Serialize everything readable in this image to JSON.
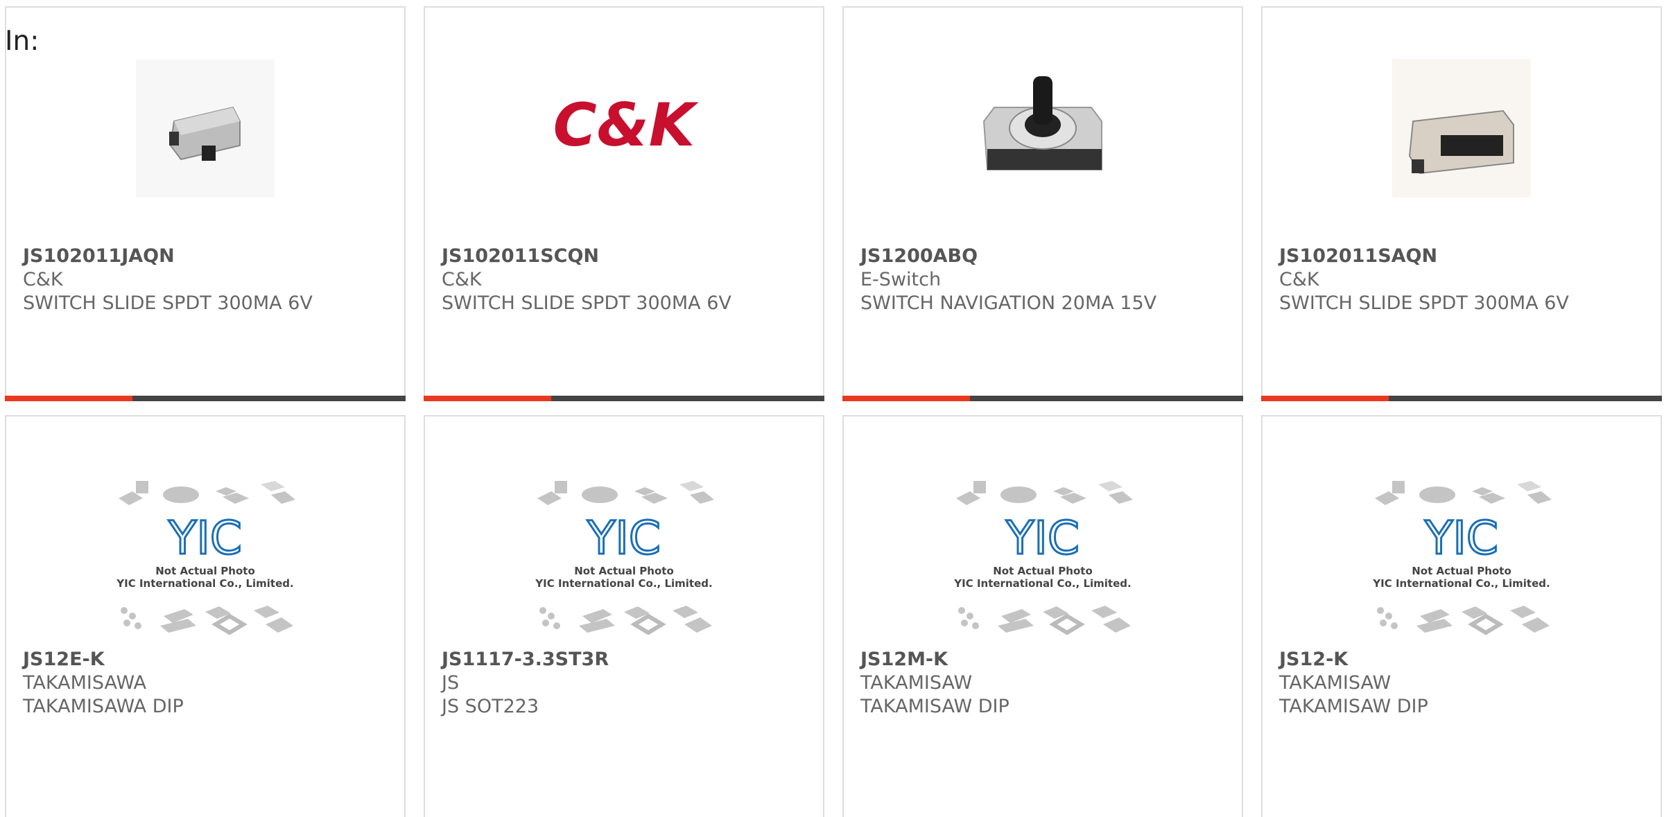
{
  "page_label": "In:",
  "products": [
    {
      "part_number": "JS102011JAQN",
      "manufacturer": "C&K",
      "description": "SWITCH SLIDE SPDT 300MA 6V",
      "image": "slide-switch-photo"
    },
    {
      "part_number": "JS102011SCQN",
      "manufacturer": "C&K",
      "description": "SWITCH SLIDE SPDT 300MA 6V",
      "image": "ck-logo",
      "logo_text": "C&K"
    },
    {
      "part_number": "JS1200ABQ",
      "manufacturer": "E-Switch",
      "description": "SWITCH NAVIGATION 20MA 15V",
      "image": "navigation-switch-photo"
    },
    {
      "part_number": "JS102011SAQN",
      "manufacturer": "C&K",
      "description": "SWITCH SLIDE SPDT 300MA 6V",
      "image": "slide-switch-photo"
    },
    {
      "part_number": "JS12E-K",
      "manufacturer": "TAKAMISAWA",
      "description": "TAKAMISAWA DIP",
      "image": "placeholder-photo"
    },
    {
      "part_number": "JS1117-3.3ST3R",
      "manufacturer": "JS",
      "description": "JS SOT223",
      "image": "placeholder-photo"
    },
    {
      "part_number": "JS12M-K",
      "manufacturer": "TAKAMISAW",
      "description": "TAKAMISAW DIP",
      "image": "placeholder-photo"
    },
    {
      "part_number": "JS12-K",
      "manufacturer": "TAKAMISAW",
      "description": "TAKAMISAW DIP",
      "image": "placeholder-photo"
    }
  ],
  "placeholder": {
    "logo_text": "YIC",
    "line1": "Not Actual Photo",
    "line2": "YIC International Co., Limited."
  },
  "colors": {
    "accent": "#e8391f",
    "bar": "#444444",
    "ck_red": "#c8102e",
    "yic_blue": "#1a6fb5"
  }
}
